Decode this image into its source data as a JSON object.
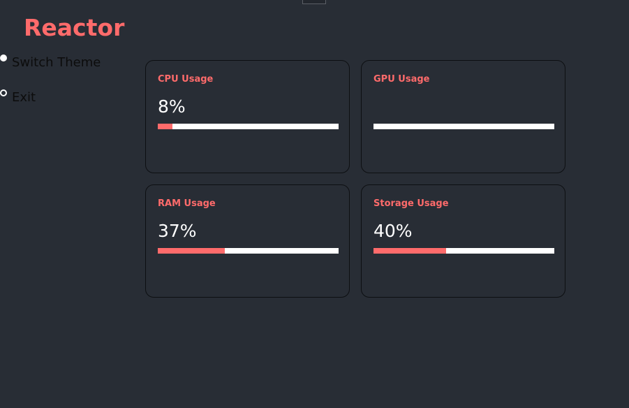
{
  "app": {
    "title": "Reactor"
  },
  "menu": {
    "items": [
      {
        "label": "Switch Theme",
        "icon": "radio-filled-icon"
      },
      {
        "label": "Exit",
        "icon": "radio-hollow-icon"
      }
    ]
  },
  "cards": [
    {
      "title": "CPU Usage",
      "value_text": "8%",
      "percent": 8
    },
    {
      "title": "GPU Usage",
      "value_text": "",
      "percent": 0
    },
    {
      "title": "RAM Usage",
      "value_text": "37%",
      "percent": 37
    },
    {
      "title": "Storage Usage",
      "value_text": "40%",
      "percent": 40
    }
  ],
  "colors": {
    "background": "#282d35",
    "accent": "#ff6b6b",
    "bar_track": "#ffffff",
    "value_text": "#ffffff"
  }
}
